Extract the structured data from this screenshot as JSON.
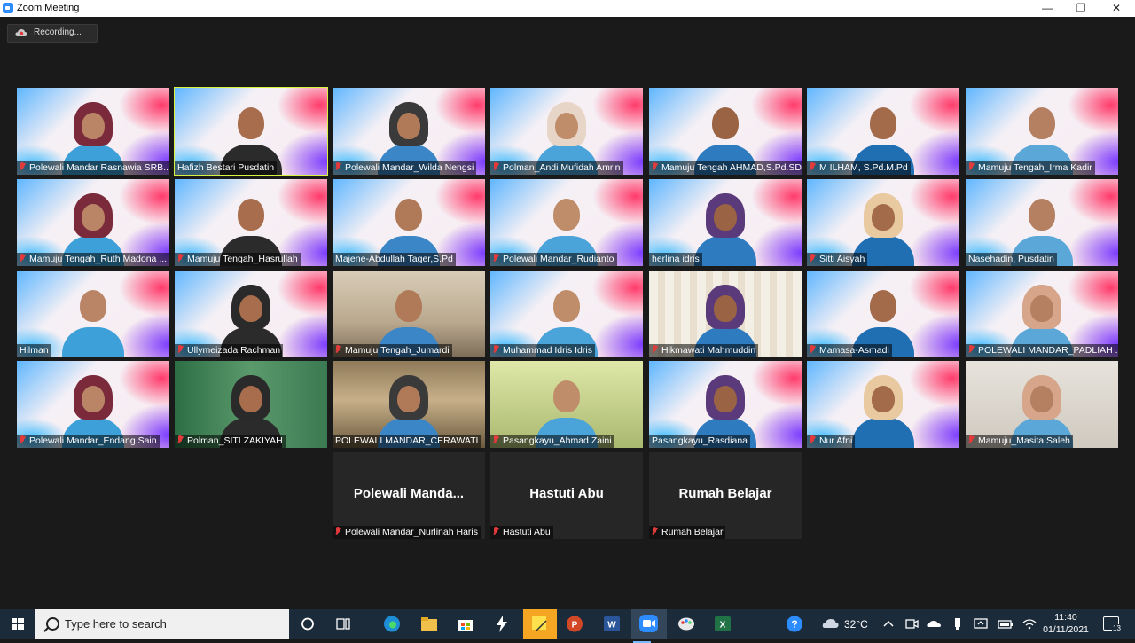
{
  "window": {
    "title": "Zoom Meeting",
    "minimize": "—",
    "maximize": "❐",
    "close": "✕"
  },
  "recording": {
    "label": "Recording..."
  },
  "participants": [
    {
      "name": "Polewali Mandar Rasnawia SRB...",
      "muted": true
    },
    {
      "name": "Hafizh Bestari Pusdatin",
      "muted": false,
      "active": true
    },
    {
      "name": "Polewali Mandar_Wilda Nengsi",
      "muted": true
    },
    {
      "name": "Polman_Andi Mufidah Amrin",
      "muted": true
    },
    {
      "name": "Mamuju Tengah AHMAD,S.Pd.SD",
      "muted": true
    },
    {
      "name": "M ILHAM, S.Pd.M.Pd",
      "muted": true
    },
    {
      "name": "Mamuju Tengah_Irma Kadir",
      "muted": true
    },
    {
      "name": "Mamuju Tengah_Ruth Madona ...",
      "muted": true
    },
    {
      "name": "Mamuju Tengah_Hasrullah",
      "muted": true
    },
    {
      "name": "Majene-Abdullah Tager,S.Pd",
      "muted": false
    },
    {
      "name": "Polewali Mandar_Rudianto",
      "muted": true
    },
    {
      "name": "herlina idris",
      "muted": false
    },
    {
      "name": "Sitti Aisyah",
      "muted": true
    },
    {
      "name": "Nasehadin, Pusdatin",
      "muted": false
    },
    {
      "name": "Hilman",
      "muted": false
    },
    {
      "name": "Ullymeizada Rachman",
      "muted": true
    },
    {
      "name": "Mamuju Tengah_Jumardi",
      "muted": true
    },
    {
      "name": "Muhammad Idris Idris",
      "muted": true
    },
    {
      "name": "Hikmawati Mahmuddin",
      "muted": true
    },
    {
      "name": "Mamasa-Asmadi",
      "muted": true
    },
    {
      "name": "POLEWALI MANDAR_PADLIAH ...",
      "muted": true
    },
    {
      "name": "Polewali Mandar_Endang Sain",
      "muted": true
    },
    {
      "name": "Polman_SITI ZAKIYAH",
      "muted": true
    },
    {
      "name": "POLEWALI MANDAR_CERAWATI",
      "muted": false
    },
    {
      "name": "Pasangkayu_Ahmad Zaini",
      "muted": true
    },
    {
      "name": "Pasangkayu_Rasdiana",
      "muted": false
    },
    {
      "name": "Nur Afni",
      "muted": true
    },
    {
      "name": "Mamuju_Masita Saleh",
      "muted": true
    },
    {
      "name": "Polewali Mandar_Nurlinah Haris",
      "muted": true,
      "display": "Polewali  Manda..."
    },
    {
      "name": "Hastuti Abu",
      "muted": true,
      "display": "Hastuti Abu"
    },
    {
      "name": "Rumah Belajar",
      "muted": true,
      "display": "Rumah Belajar"
    }
  ],
  "taskbar": {
    "search_placeholder": "Type here to search",
    "weather": "32°C",
    "time": "11:40",
    "date": "01/11/2021",
    "notifications": "13",
    "icons": [
      "windows-start-icon",
      "task-view-icon",
      "multitasking-icon",
      "edge-icon",
      "file-explorer-icon",
      "store-icon",
      "app-bolt-icon",
      "sticky-notes-icon",
      "powerpoint-icon",
      "word-icon",
      "zoom-icon",
      "paint-icon",
      "excel-icon"
    ],
    "colors": {
      "accent": "#2d8cff",
      "active_speaker": "#d7f23f",
      "muted": "#e23b3b"
    }
  }
}
